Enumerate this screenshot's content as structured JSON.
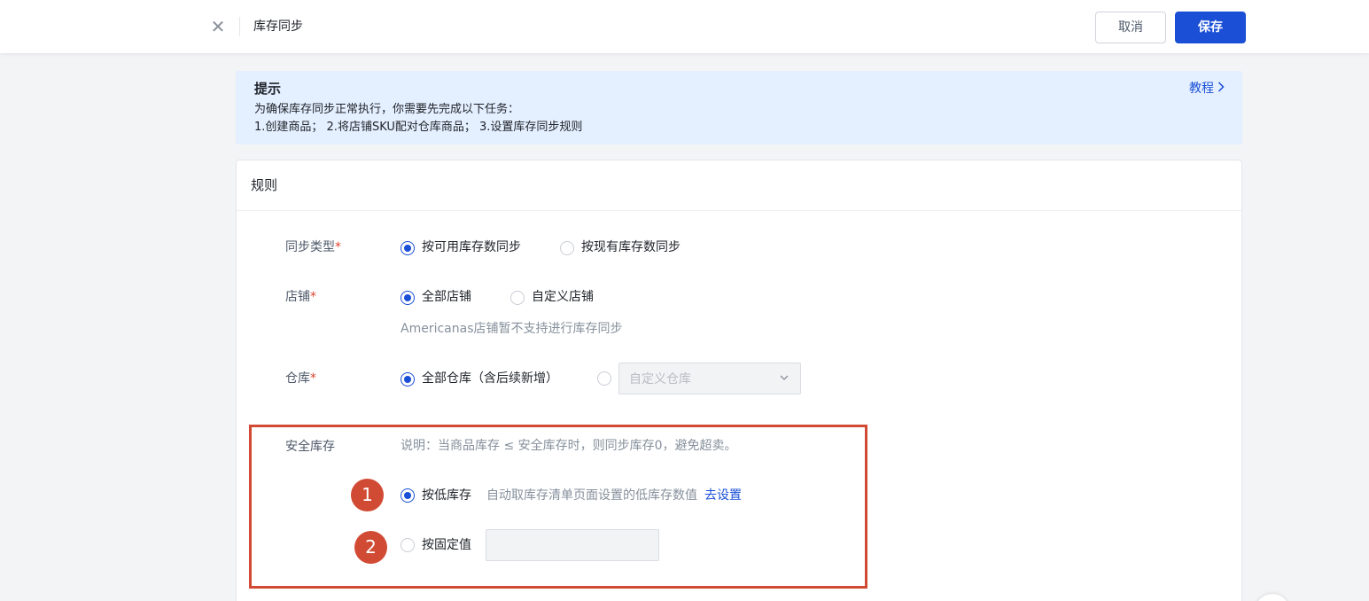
{
  "header": {
    "close_icon": "close-icon",
    "title": "库存同步",
    "cancel_label": "取消",
    "save_label": "保存"
  },
  "tip": {
    "title": "提示",
    "line1": "为确保库存同步正常执行，你需要先完成以下任务：",
    "line2": "1.创建商品； 2.将店铺SKU配对仓库商品； 3.设置库存同步规则",
    "tutorial_label": "教程"
  },
  "rules": {
    "title": "规则",
    "sync_type": {
      "label": "同步类型",
      "required_mark": "*",
      "options": [
        "按可用库存数同步",
        "按现有库存数同步"
      ],
      "selected": 0
    },
    "store": {
      "label": "店铺",
      "required_mark": "*",
      "options": [
        "全部店铺",
        "自定义店铺"
      ],
      "selected": 0,
      "note": "Americanas店铺暂不支持进行库存同步"
    },
    "warehouse": {
      "label": "仓库",
      "required_mark": "*",
      "options": [
        "全部仓库（含后续新增）"
      ],
      "selected": 0,
      "custom_select_placeholder": "自定义仓库"
    },
    "safety_stock": {
      "label": "安全库存",
      "description": "说明：当商品库存 ≤ 安全库存时，则同步库存0，避免超卖。",
      "options": [
        "按低库存",
        "按固定值"
      ],
      "selected": 0,
      "low_stock_hint": "自动取库存清单页面设置的低库存数值",
      "go_setting_label": "去设置",
      "fixed_value": ""
    }
  },
  "annotations": {
    "marker1": "1",
    "marker2": "2",
    "highlight_color": "#d14b34"
  },
  "colors": {
    "primary": "#1a4fd6",
    "tip_bg": "#e4efff",
    "required": "#e0432f"
  }
}
